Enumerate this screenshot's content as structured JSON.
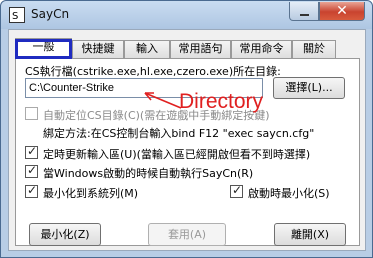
{
  "window": {
    "title": "SayCn"
  },
  "tabs": [
    {
      "label": "一般"
    },
    {
      "label": "快捷鍵"
    },
    {
      "label": "輸入"
    },
    {
      "label": "常用語句"
    },
    {
      "label": "常用命令"
    },
    {
      "label": "關於"
    }
  ],
  "general": {
    "path_label": "CS執行檔(cstrike.exe,hl.exe,czero.exe)所在目錄:",
    "path_value": "C:\\Counter-Strike",
    "browse_label": "選擇(L)...",
    "auto_locate_label": "自動定位CS目錄(C)(需在遊戲中手動綁定按鍵)",
    "bind_hint": "綁定方法:在CS控制台輸入bind F12 \"exec saycn.cfg\"",
    "timer_refresh_label": "定時更新輸入區(U)(當輸入區已經開啟但看不到時選擇)",
    "autorun_label": "當Windows啟動的時候自動執行SayCn(R)",
    "minimize_tray_label": "最小化到系統列(M)",
    "start_minimized_label": "啟動時最小化(S)",
    "auto_locate_checked": false,
    "timer_refresh_checked": true,
    "autorun_checked": true,
    "minimize_tray_checked": true,
    "start_minimized_checked": true
  },
  "buttons": {
    "minimize": "最小化(Z)",
    "apply": "套用(A)",
    "exit": "離開(X)"
  },
  "annotation": {
    "text": "Directory",
    "color": "#e02020"
  },
  "colors": {
    "highlight_border": "#1f2bc0",
    "close_button": "#c9432f"
  }
}
